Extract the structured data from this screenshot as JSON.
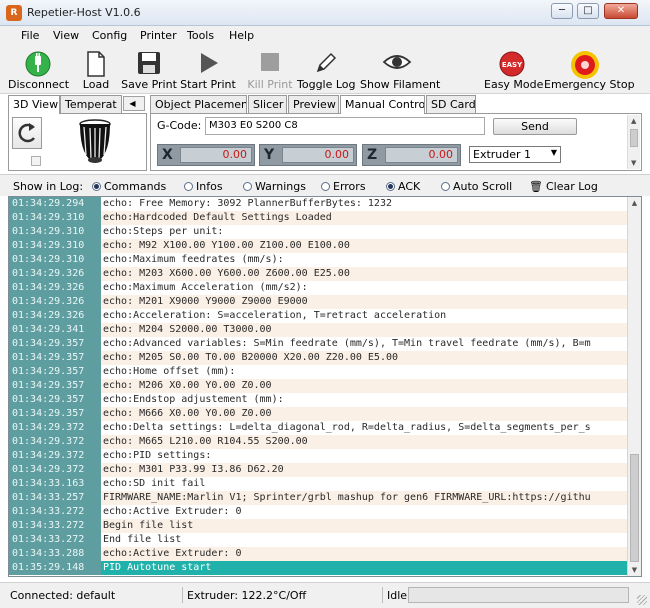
{
  "window": {
    "title": "Repetier-Host V1.0.6",
    "minimize": "─",
    "maximize": "□",
    "close": "✕"
  },
  "menu": [
    "File",
    "View",
    "Config",
    "Printer",
    "Tools",
    "Help"
  ],
  "toolbar": {
    "disconnect": "Disconnect",
    "load": "Load",
    "save_print": "Save Print",
    "start_print": "Start Print",
    "kill_print": "Kill Print",
    "toggle_log": "Toggle Log",
    "show_filament": "Show Filament",
    "easy_mode": "Easy Mode",
    "easy_badge": "EASY",
    "emergency_stop": "Emergency Stop"
  },
  "left_tabs": {
    "view3d": "3D View",
    "temperature": "Temperat",
    "arrows": "◀ ▶"
  },
  "right_tabs": [
    "Object Placement",
    "Slicer",
    "Preview",
    "Manual Control",
    "SD Card"
  ],
  "manual": {
    "gcode_label": "G-Code:",
    "gcode_value": "M303 E0 S200 C8",
    "send": "Send",
    "x": {
      "label": "X",
      "value": "0.00"
    },
    "y": {
      "label": "Y",
      "value": "0.00"
    },
    "z": {
      "label": "Z",
      "value": "0.00"
    },
    "extruder": "Extruder 1"
  },
  "log_filter": {
    "show_in_log": "Show in Log:",
    "commands": "Commands",
    "infos": "Infos",
    "warnings": "Warnings",
    "errors": "Errors",
    "ack": "ACK",
    "auto_scroll": "Auto Scroll",
    "clear_log": "Clear Log"
  },
  "log": [
    {
      "time": "01:34:29.294",
      "msg": "echo: Free Memory: 3092  PlannerBufferBytes: 1232"
    },
    {
      "time": "01:34:29.310",
      "msg": "echo:Hardcoded Default Settings Loaded"
    },
    {
      "time": "01:34:29.310",
      "msg": "echo:Steps per unit:"
    },
    {
      "time": "01:34:29.310",
      "msg": "echo:   M92 X100.00 Y100.00 Z100.00 E100.00"
    },
    {
      "time": "01:34:29.310",
      "msg": "echo:Maximum feedrates (mm/s):"
    },
    {
      "time": "01:34:29.326",
      "msg": "echo:   M203 X600.00 Y600.00 Z600.00 E25.00"
    },
    {
      "time": "01:34:29.326",
      "msg": "echo:Maximum Acceleration (mm/s2):"
    },
    {
      "time": "01:34:29.326",
      "msg": "echo:   M201 X9000 Y9000 Z9000 E9000"
    },
    {
      "time": "01:34:29.326",
      "msg": "echo:Acceleration: S=acceleration, T=retract acceleration"
    },
    {
      "time": "01:34:29.341",
      "msg": "echo:   M204 S2000.00 T3000.00"
    },
    {
      "time": "01:34:29.357",
      "msg": "echo:Advanced variables: S=Min feedrate (mm/s), T=Min travel feedrate (mm/s), B=m"
    },
    {
      "time": "01:34:29.357",
      "msg": "echo:   M205 S0.00 T0.00 B20000 X20.00 Z20.00 E5.00"
    },
    {
      "time": "01:34:29.357",
      "msg": "echo:Home offset (mm):"
    },
    {
      "time": "01:34:29.357",
      "msg": "echo:   M206 X0.00 Y0.00 Z0.00"
    },
    {
      "time": "01:34:29.357",
      "msg": "echo:Endstop adjustement (mm):"
    },
    {
      "time": "01:34:29.357",
      "msg": "echo:   M666 X0.00 Y0.00 Z0.00"
    },
    {
      "time": "01:34:29.372",
      "msg": "echo:Delta settings: L=delta_diagonal_rod, R=delta_radius, S=delta_segments_per_s"
    },
    {
      "time": "01:34:29.372",
      "msg": "echo:   M665 L210.00 R104.55 S200.00"
    },
    {
      "time": "01:34:29.372",
      "msg": "echo:PID settings:"
    },
    {
      "time": "01:34:29.372",
      "msg": "echo:    M301 P33.99 I3.86 D62.20"
    },
    {
      "time": "01:34:33.163",
      "msg": "echo:SD init fail"
    },
    {
      "time": "01:34:33.257",
      "msg": "FIRMWARE_NAME:Marlin V1; Sprinter/grbl mashup for gen6 FIRMWARE_URL:https://githu"
    },
    {
      "time": "01:34:33.272",
      "msg": "echo:Active Extruder: 0"
    },
    {
      "time": "01:34:33.272",
      "msg": "Begin file list"
    },
    {
      "time": "01:34:33.272",
      "msg": "End file list"
    },
    {
      "time": "01:34:33.288",
      "msg": "echo:Active Extruder: 0"
    },
    {
      "time": "01:35:29.148",
      "msg": "PID Autotune start"
    }
  ],
  "status": {
    "connection": "Connected: default",
    "extruder": "Extruder: 122.2°C/Off",
    "state": "Idle",
    "progress": 0
  },
  "colors": {
    "time_bg": "#5f9ea0",
    "alt_row": "#faf0e6",
    "selected_row": "#20b2aa",
    "axis_value": "#c81818"
  }
}
